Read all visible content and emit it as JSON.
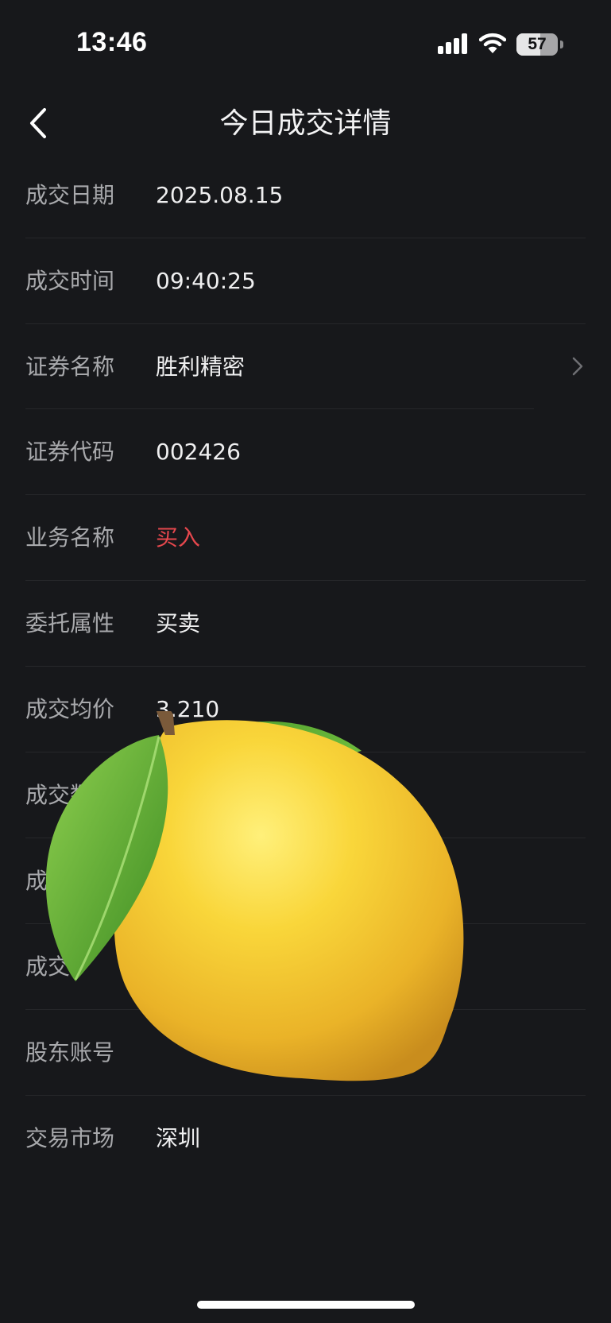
{
  "status_bar": {
    "time": "13:46",
    "battery_level": "57",
    "battery_fraction": 0.57,
    "icons": [
      "signal-bars-icon",
      "wifi-icon",
      "battery-icon"
    ]
  },
  "nav": {
    "title": "今日成交详情",
    "back_icon": "chevron-left-icon"
  },
  "rows": [
    {
      "label": "成交日期",
      "value": "2025.08.15"
    },
    {
      "label": "成交时间",
      "value": "09:40:25"
    },
    {
      "label": "证券名称",
      "value": "胜利精密",
      "has_chevron": true
    },
    {
      "label": "证券代码",
      "value": "002426"
    },
    {
      "label": "业务名称",
      "value": "买入",
      "value_color": "#e5474d"
    },
    {
      "label": "委托属性",
      "value": "买卖"
    },
    {
      "label": "成交均价",
      "value": "3.210"
    },
    {
      "label": "成交数量",
      "value": ""
    },
    {
      "label": "成交",
      "value": ""
    },
    {
      "label": "成交",
      "value": ""
    },
    {
      "label": "股东账号",
      "value": ""
    },
    {
      "label": "交易市场",
      "value": "深圳"
    }
  ],
  "colors": {
    "background": "#17181b",
    "label": "#a8a9ac",
    "value": "#efeff0",
    "buy": "#e5474d",
    "divider": "#26272a"
  },
  "overlay": {
    "icon": "lemon-emoji"
  }
}
